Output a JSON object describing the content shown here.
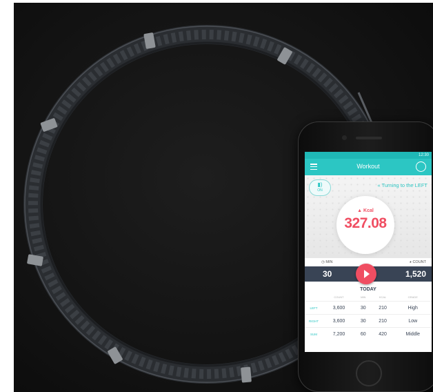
{
  "app": {
    "status_time": "12:30",
    "title": "Workout",
    "sound": {
      "icon": "speaker-icon",
      "label": "ON"
    },
    "direction_text": "Turning to the LEFT",
    "kcal_label": "Kcal",
    "kcal_value": "327.08",
    "min_label": "MIN",
    "count_label": "COUNT",
    "minutes": "30",
    "count": "1,520",
    "today_label": "TODAY",
    "table": {
      "headers": [
        "",
        "COUNT",
        "MIN",
        "KCAL",
        "GRADE"
      ],
      "rows": [
        {
          "label": "LEFT",
          "count": "3,600",
          "min": "30",
          "kcal": "210",
          "grade": "High"
        },
        {
          "label": "RIGHT",
          "count": "3,600",
          "min": "30",
          "kcal": "210",
          "grade": "Low"
        },
        {
          "label": "SUM",
          "count": "7,200",
          "min": "60",
          "kcal": "420",
          "grade": "Middle"
        }
      ]
    },
    "colors": {
      "teal": "#2cc6c3",
      "accent_red": "#f04e62",
      "dark_bar": "#394455"
    }
  }
}
